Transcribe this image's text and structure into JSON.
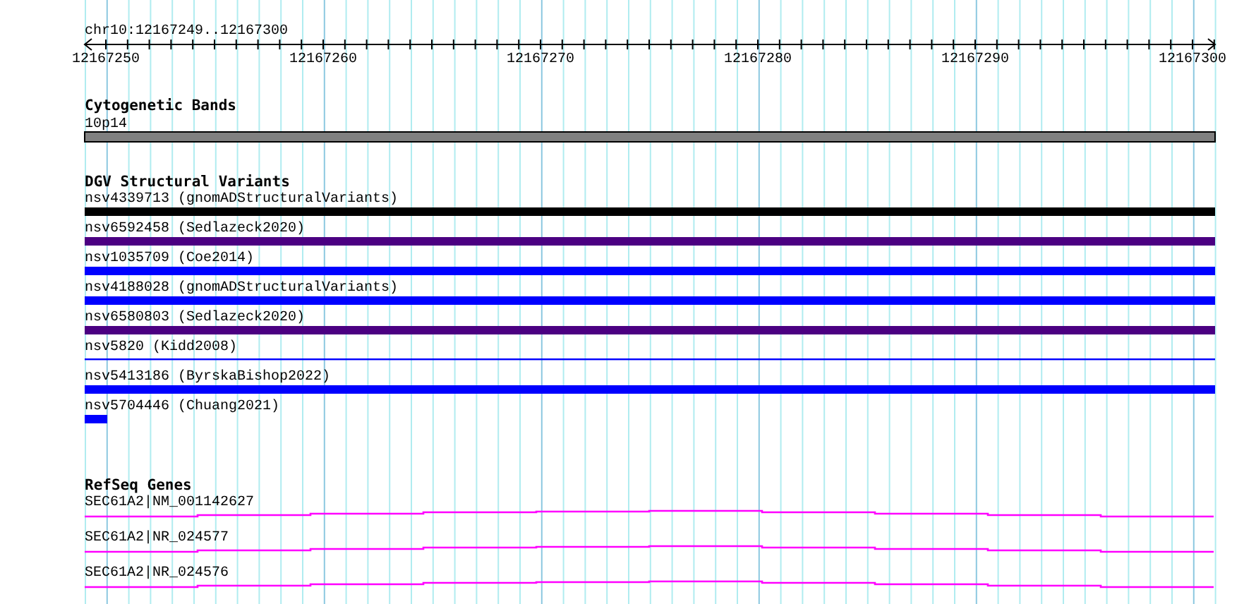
{
  "ruler": {
    "location": "chr10:12167249..12167300",
    "tick_labels": [
      "12167250",
      "12167260",
      "12167270",
      "12167280",
      "12167290",
      "12167300"
    ]
  },
  "cytogenetic_bands": {
    "title": "Cytogenetic Bands",
    "bands": [
      {
        "label": "10p14",
        "color": "#808080"
      }
    ]
  },
  "dgv_structural_variants": {
    "title": "DGV Structural Variants",
    "variants": [
      {
        "label": "nsv4339713 (gnomADStructuralVariants)",
        "color": "#000000",
        "kind": "full"
      },
      {
        "label": "nsv6592458 (Sedlazeck2020)",
        "color": "#4b0082",
        "kind": "full"
      },
      {
        "label": "nsv1035709 (Coe2014)",
        "color": "#0000ff",
        "kind": "full"
      },
      {
        "label": "nsv4188028 (gnomADStructuralVariants)",
        "color": "#0000ff",
        "kind": "full"
      },
      {
        "label": "nsv6580803 (Sedlazeck2020)",
        "color": "#4b0082",
        "kind": "full"
      },
      {
        "label": "nsv5820 (Kidd2008)",
        "color": "#0000ff",
        "kind": "thin"
      },
      {
        "label": "nsv5413186 (ByrskaBishop2022)",
        "color": "#0000ff",
        "kind": "full"
      },
      {
        "label": "nsv5704446 (Chuang2021)",
        "color": "#0000ff",
        "kind": "short"
      }
    ]
  },
  "refseq_genes": {
    "title": "RefSeq Genes",
    "genes": [
      {
        "label": "SEC61A2|NM_001142627"
      },
      {
        "label": "SEC61A2|NR_024577"
      },
      {
        "label": "SEC61A2|NR_024576"
      }
    ]
  }
}
